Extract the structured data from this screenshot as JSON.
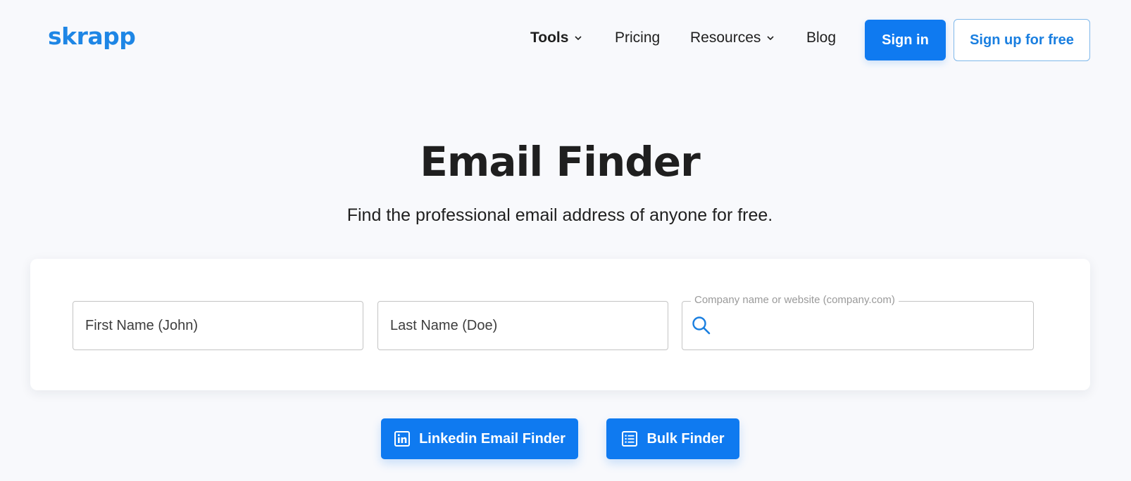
{
  "brand": {
    "logo_text": "skrapp",
    "accent_color": "#0f7af0",
    "logo_color": "#1e86e5"
  },
  "nav": {
    "items": [
      {
        "label": "Tools",
        "has_dropdown": true,
        "active": true
      },
      {
        "label": "Pricing",
        "has_dropdown": false
      },
      {
        "label": "Resources",
        "has_dropdown": true
      },
      {
        "label": "Blog",
        "has_dropdown": false
      }
    ],
    "sign_in_label": "Sign in",
    "sign_up_label": "Sign up for free"
  },
  "hero": {
    "title": "Email Finder",
    "subtitle": "Find the professional email address of anyone for free."
  },
  "search_form": {
    "first_name": {
      "placeholder": "First Name (John)",
      "value": ""
    },
    "last_name": {
      "placeholder": "Last Name (Doe)",
      "value": ""
    },
    "company": {
      "label": "Company name or website (company.com)",
      "value": "",
      "icon": "search-icon"
    }
  },
  "actions": {
    "linkedin_label": "Linkedin Email Finder",
    "linkedin_icon": "linkedin-icon",
    "bulk_label": "Bulk Finder",
    "bulk_icon": "list-icon"
  }
}
